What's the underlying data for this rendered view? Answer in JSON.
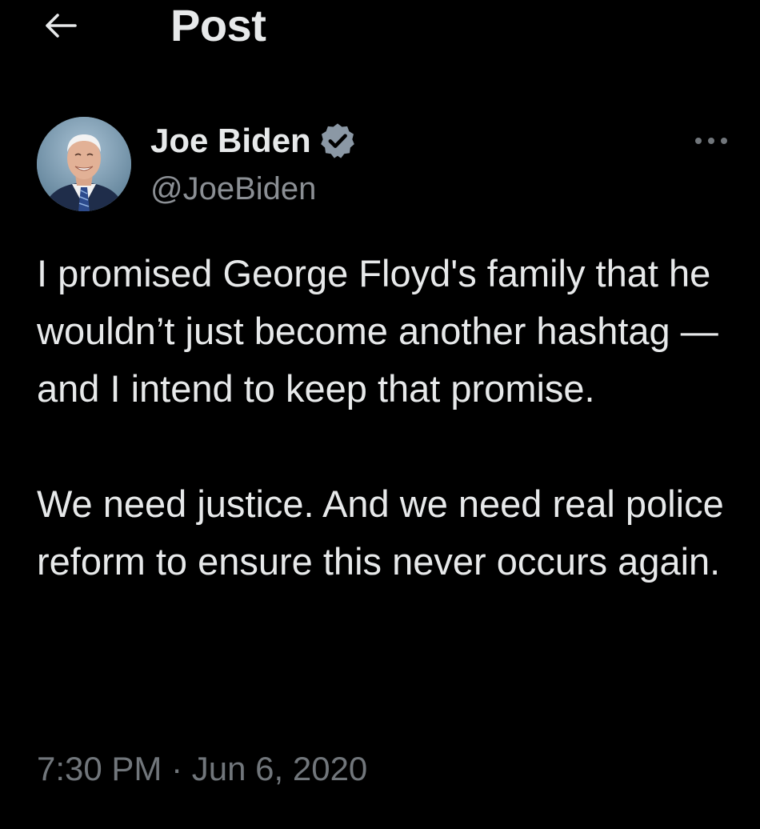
{
  "header": {
    "title": "Post",
    "back_icon": "arrow-left-icon"
  },
  "author": {
    "display_name": "Joe Biden",
    "handle": "@JoeBiden",
    "verified": true,
    "verified_icon": "verified-badge-icon",
    "more_icon": "more-horizontal-icon"
  },
  "tweet": {
    "paragraphs": [
      "I promised George Floyd's family that he wouldn’t just become another hashtag — and I intend to keep that promise.",
      "We need justice. And we need real police reform to ensure this never occurs again."
    ],
    "time": "7:30 PM",
    "separator": "·",
    "date": "Jun 6, 2020"
  },
  "colors": {
    "background": "#000000",
    "primary_text": "#e7e9ea",
    "secondary_text": "#71767b",
    "handle_text": "#8b8f94",
    "badge": "#8b98a5"
  }
}
